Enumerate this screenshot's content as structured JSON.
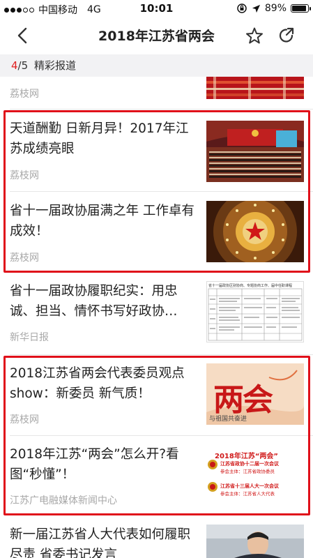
{
  "status_bar": {
    "carrier": "中国移动",
    "network": "4G",
    "time": "10:01",
    "battery": "89%",
    "battery_level": 0.89
  },
  "nav": {
    "title": "2018年江苏省两会",
    "back_icon": "chevron-left-icon",
    "star_icon": "star-icon",
    "share_icon": "share-icon"
  },
  "section": {
    "page_current": "4",
    "page_total": "/5",
    "label": "精彩报道"
  },
  "articles": [
    {
      "title": "",
      "source": "荔枝网",
      "thumb": "red-pattern"
    },
    {
      "title": "天道酬勤 日新月异！2017年江苏成绩亮眼",
      "source": "荔枝网",
      "thumb": "assembly-hall"
    },
    {
      "title": "省十一届政协届满之年 工作卓有成效！",
      "source": "荔枝网",
      "thumb": "ceiling-star"
    },
    {
      "title": "省十一届政协履职纪实：用忠诚、担当、情怀书写好政协…",
      "source": "新华日报",
      "thumb": "document-table"
    },
    {
      "title": "2018江苏省两会代表委员观点show：新委员 新气质！",
      "source": "荔枝网",
      "thumb": "lianghui-graphic"
    },
    {
      "title": "2018年江苏“两会”怎么开?看图“秒懂”！",
      "source": "江苏广电融媒体新闻中心",
      "thumb": "infographic"
    },
    {
      "title": "新一届江苏省人大代表如何履职尽责 省委书记发言",
      "source": "",
      "thumb": "speaker-photo"
    }
  ],
  "thumb_text": {
    "lianghui": "两会",
    "lianghui_sub": "与祖国共奋进",
    "info_title": "2018年江苏“两会”",
    "info_line1": "江苏省政协十二届一次会议",
    "info_line1_sub": "参会主体：江苏省政协委员",
    "info_line2": "江苏省十三届人大一次会议",
    "info_line2_sub": "参会主体：江苏省人大代表",
    "doc_header": "省十一届政协区别协商、专题协商工作、届中任职课程"
  },
  "colors": {
    "accent_red": "#e0101a",
    "source_gray": "#a8a8a8",
    "section_bg": "#f2f2f4"
  }
}
